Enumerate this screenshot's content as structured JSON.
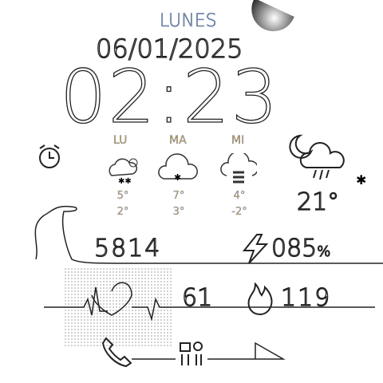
{
  "weekday": "LUNES",
  "date": "06/01/2025",
  "time": "02:23",
  "forecast": [
    {
      "day": "LU",
      "icon": "snow-sun-cloud-icon",
      "high": "5°",
      "low": "2°"
    },
    {
      "day": "MA",
      "icon": "snow-cloud-icon",
      "high": "7°",
      "low": "3°"
    },
    {
      "day": "MI",
      "icon": "fog-cloud-icon",
      "high": "4°",
      "low": "-2°"
    }
  ],
  "current_weather": {
    "icon": "night-rain-cloud-icon",
    "temperature": "21°"
  },
  "steps": "5814",
  "battery": {
    "value": "085",
    "unit": "%"
  },
  "heart_rate": "61",
  "calories": "119"
}
